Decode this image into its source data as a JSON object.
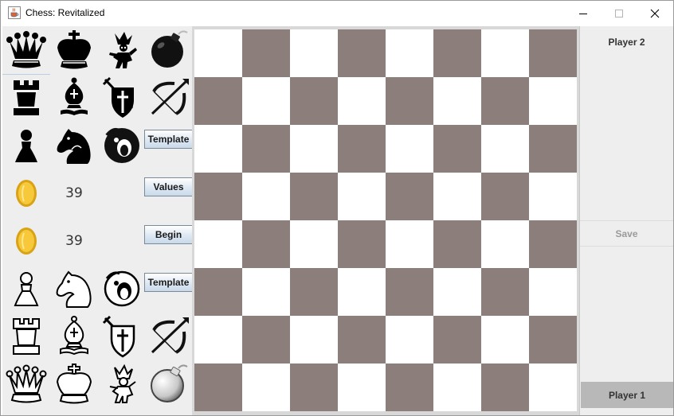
{
  "window": {
    "title": "Chess: Revitalized",
    "app_icon": "java-cup-icon",
    "controls": [
      "minimize-icon",
      "maximize-icon",
      "close-icon"
    ]
  },
  "black_palette": {
    "rows": [
      [
        "queen-icon",
        "king-icon",
        "jester-icon",
        "bomb-icon"
      ],
      [
        "rook-icon",
        "bishop-icon",
        "crusader-shield-icon",
        "crossbow-icon"
      ],
      [
        "pawn-icon",
        "knight-icon",
        "ghost-icon"
      ]
    ],
    "coins": "39"
  },
  "white_palette": {
    "rows": [
      [
        "pawn-icon",
        "knight-icon",
        "ghost-icon"
      ],
      [
        "rook-icon",
        "bishop-icon",
        "crusader-shield-icon",
        "crossbow-icon"
      ],
      [
        "queen-icon",
        "king-icon",
        "jester-icon",
        "bomb-icon"
      ]
    ],
    "coins": "39"
  },
  "buttons": {
    "template_top": "Template",
    "values": "Values",
    "begin": "Begin",
    "template_bottom": "Template"
  },
  "board": {
    "size": 8,
    "light_color": "#ffffff",
    "dark_color": "#8c7e7b"
  },
  "right_panel": {
    "player2": "Player 2",
    "save": "Save",
    "player1": "Player 1"
  }
}
